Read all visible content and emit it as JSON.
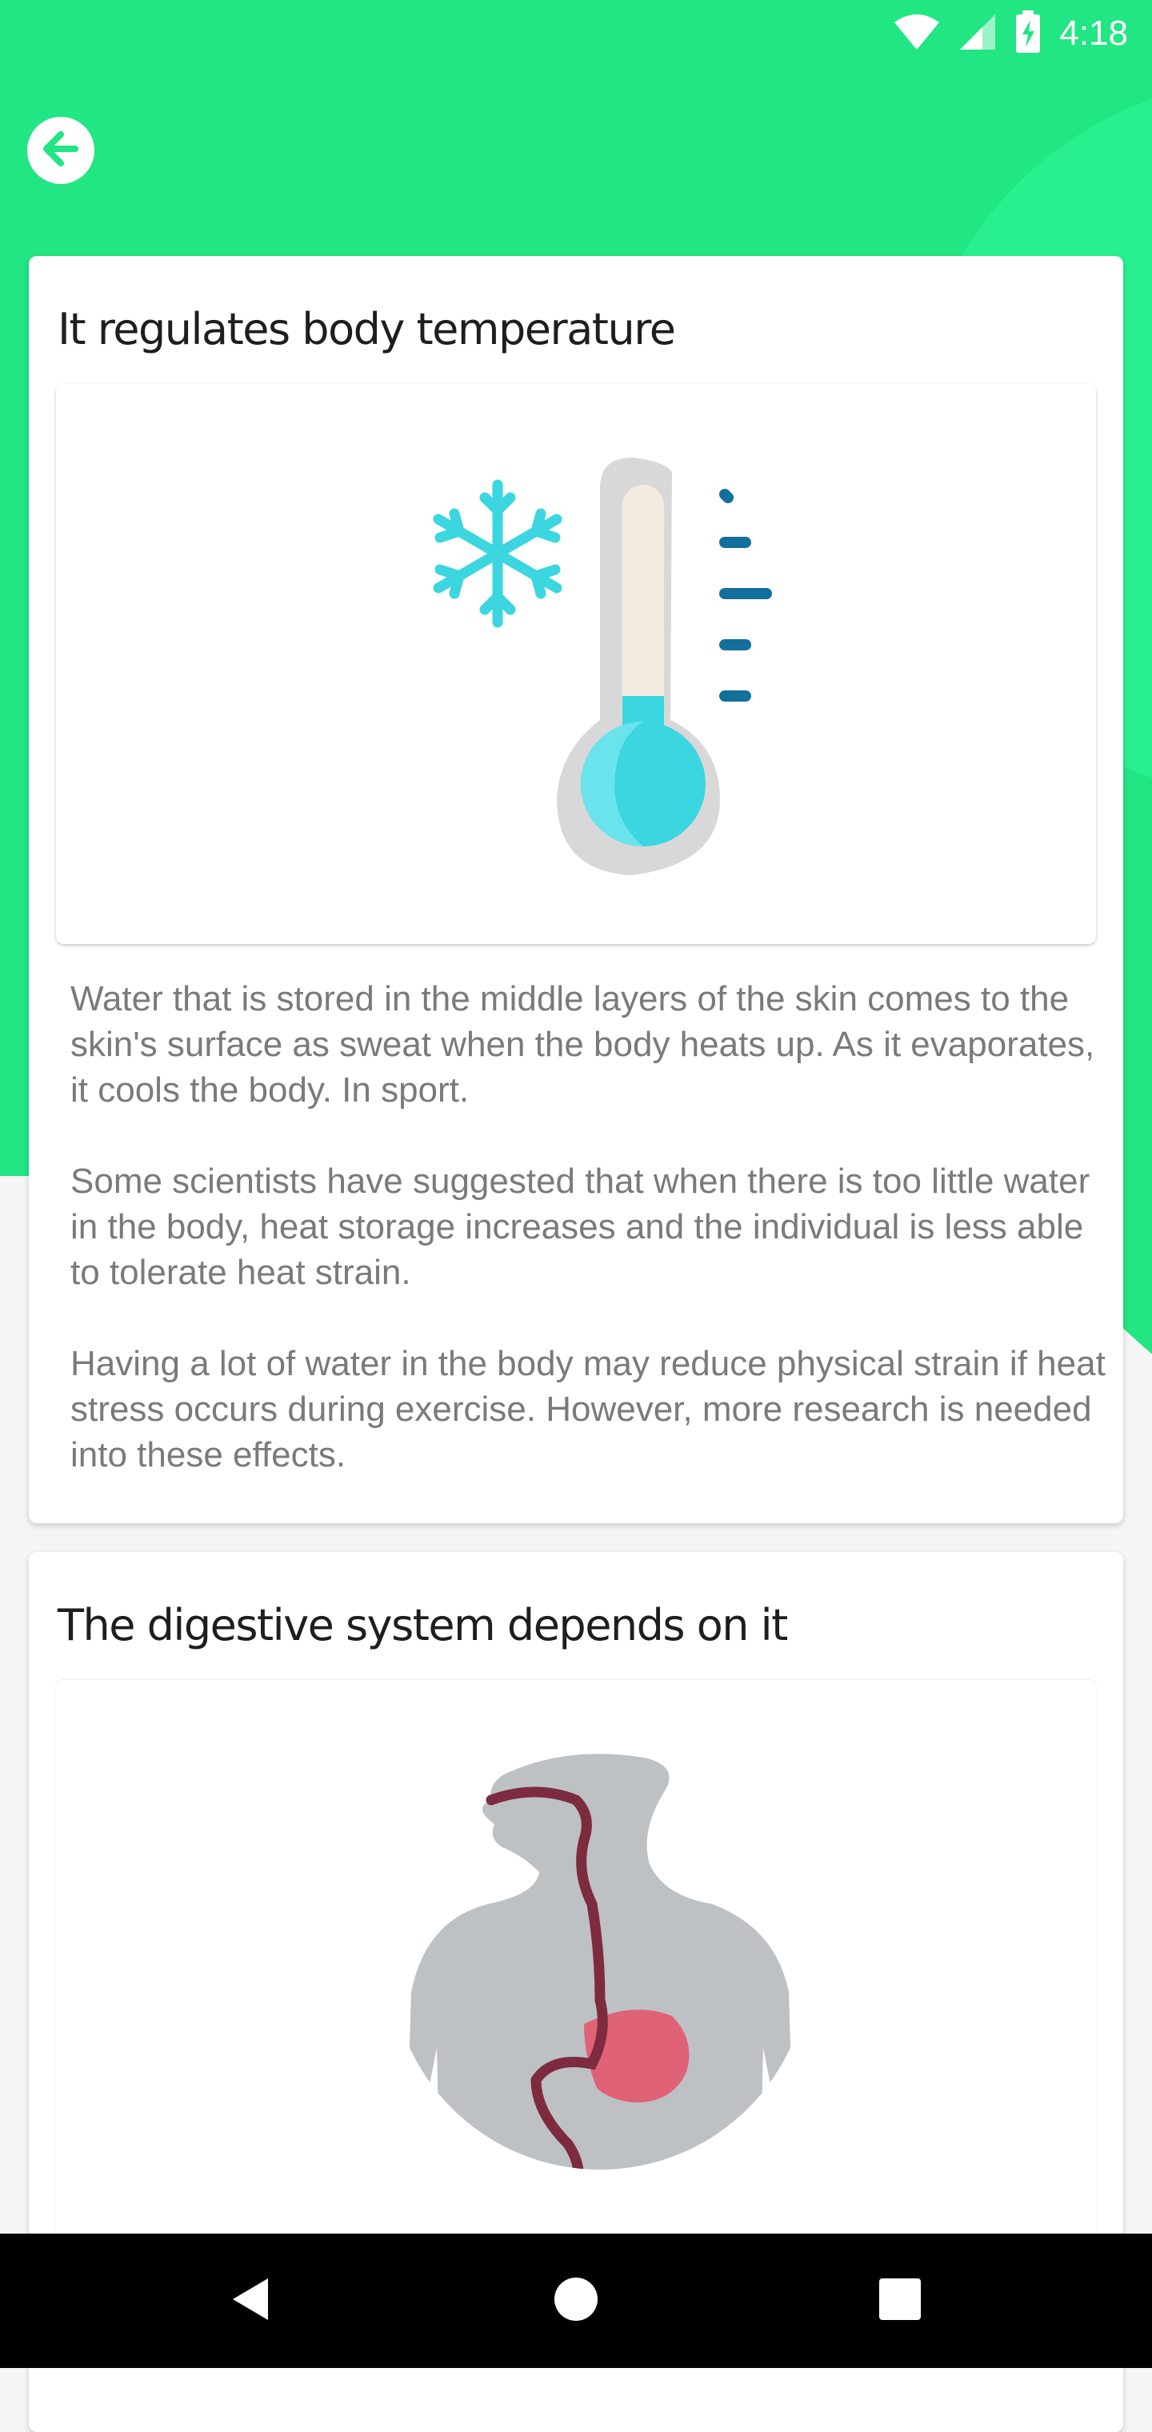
{
  "status_bar": {
    "time": "4:18",
    "icons": [
      "wifi-icon",
      "cell-signal-icon",
      "battery-charging-icon"
    ]
  },
  "colors": {
    "header_green": "#22e584",
    "light_green": "#29f08e",
    "title_text": "#1e1e1e",
    "body_text": "#7a7a7a",
    "thermo_blue": "#3bd6e0",
    "tick_blue": "#136f9c",
    "stomach_pink": "#e06277",
    "esophagus": "#7d2b3e"
  },
  "header": {
    "back_icon": "arrow-left-icon"
  },
  "cards": [
    {
      "title": "It regulates body temperature",
      "image": "thermometer-snowflake-illustration",
      "paragraphs": [
        "Water that is stored in the middle layers of the skin comes to the skin's surface as sweat when the body heats up. As it evaporates, it cools the body. In sport.",
        "Some scientists have suggested that when there is too little water in the body, heat storage increases and the individual is less able to tolerate heat strain.",
        "Having a lot of water in the body may reduce physical strain if heat stress occurs during exercise. However, more research is needed into these effects."
      ]
    },
    {
      "title": "The digestive system depends on it",
      "image": "digestive-system-illustration"
    }
  ],
  "nav_bar": {
    "buttons": [
      "back-triangle-icon",
      "home-circle-icon",
      "recents-square-icon"
    ]
  }
}
